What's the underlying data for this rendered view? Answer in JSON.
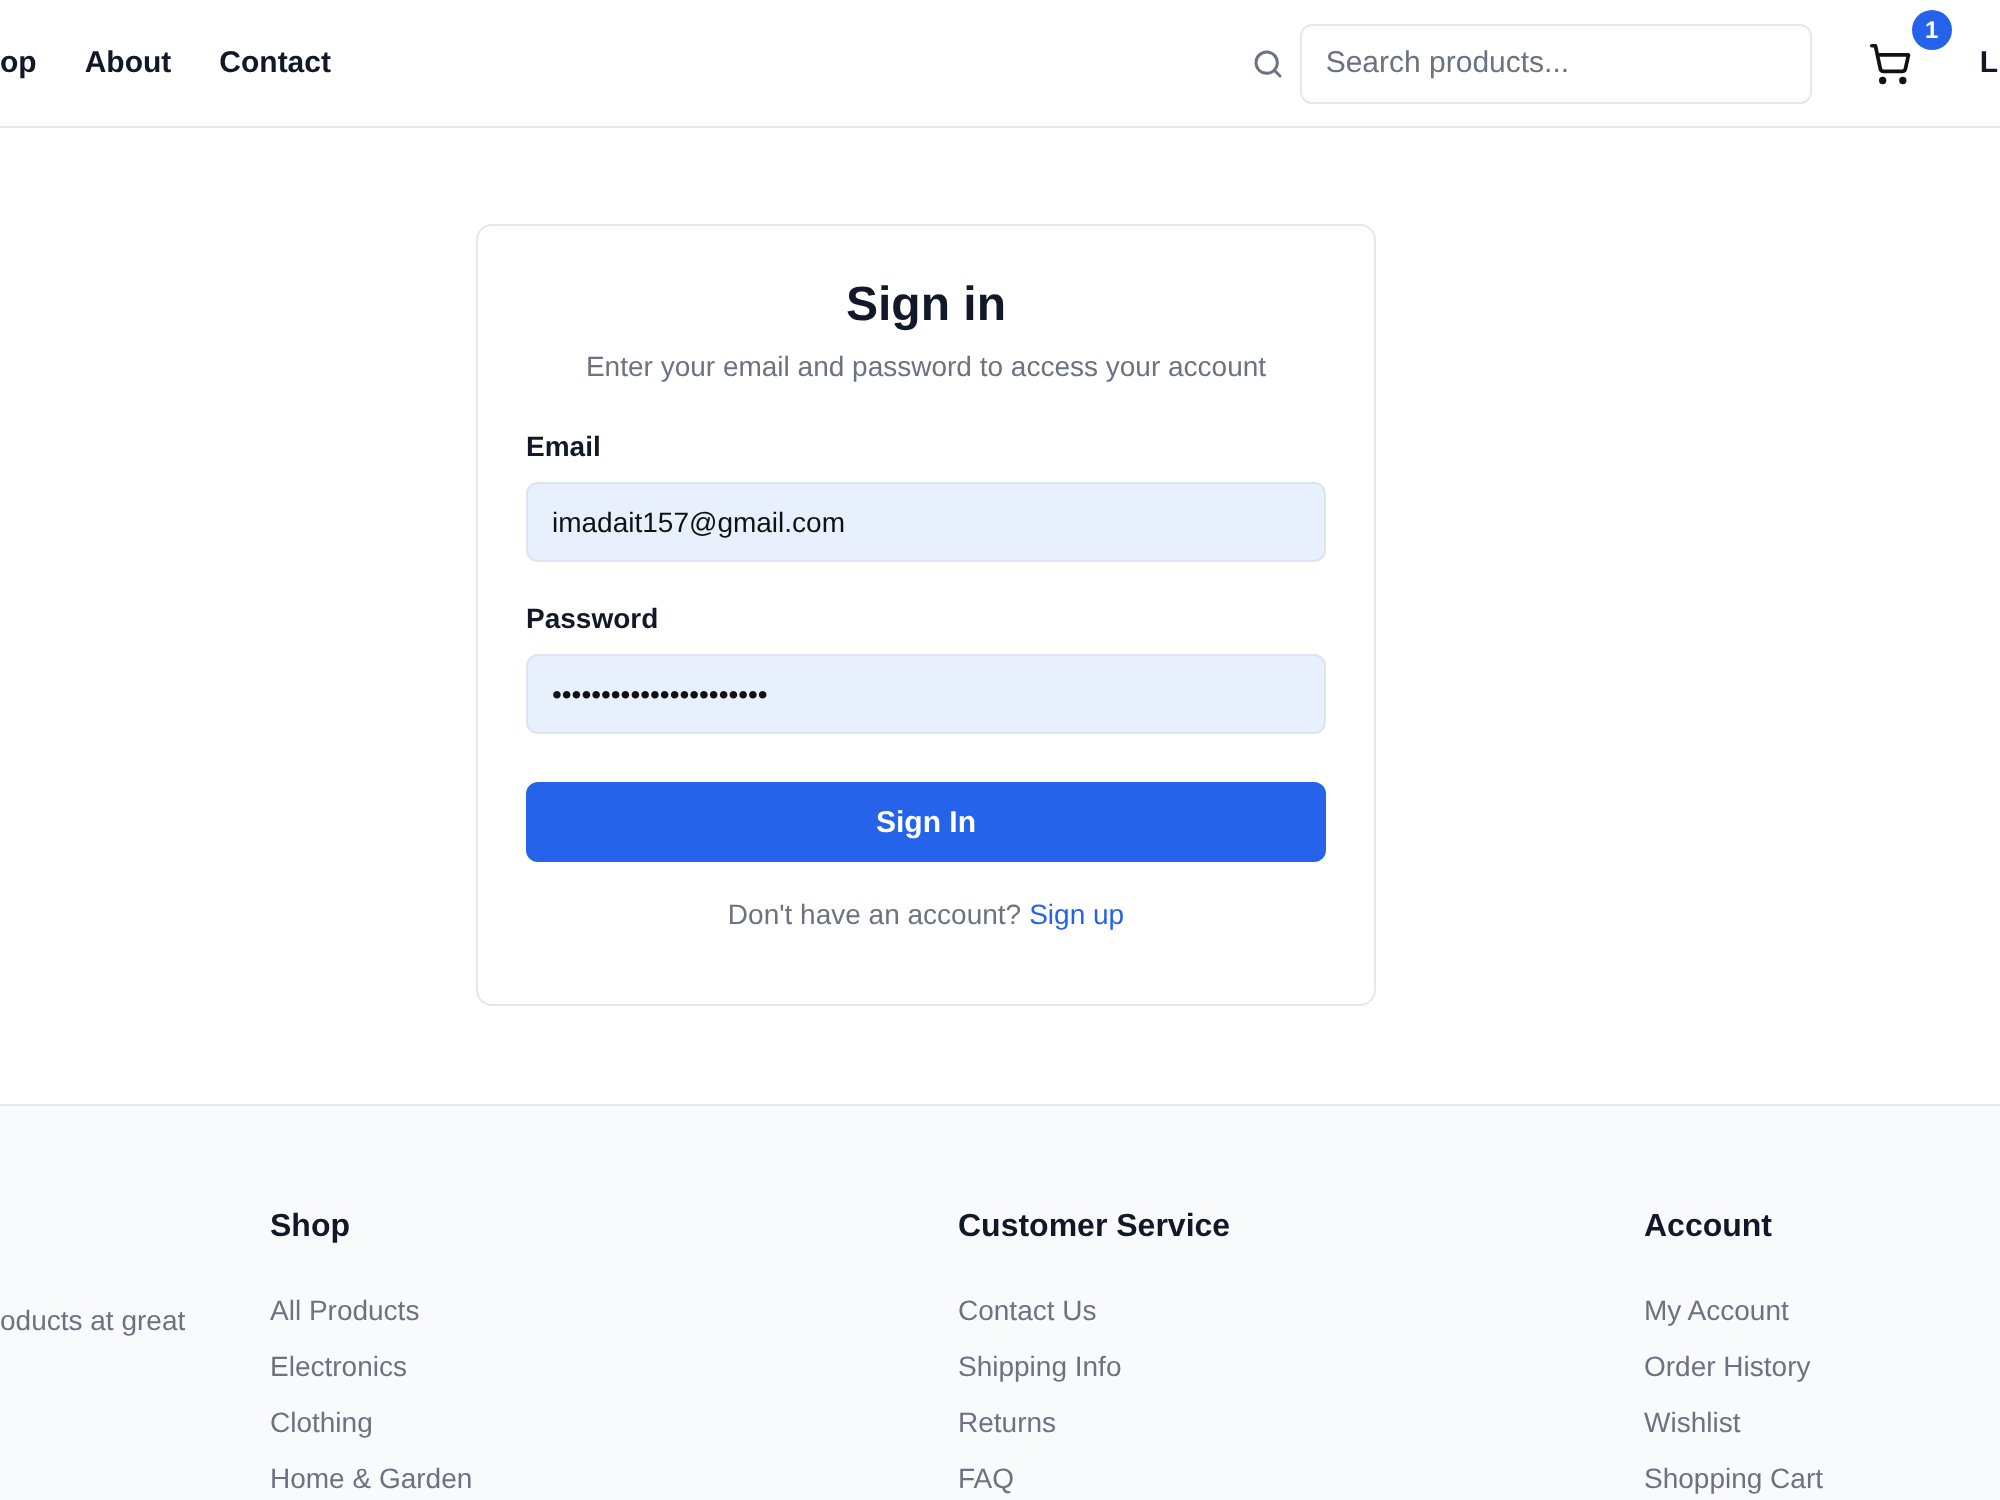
{
  "header": {
    "nav": [
      "op",
      "About",
      "Contact"
    ],
    "search": {
      "placeholder": "Search products..."
    },
    "cart_count": "1",
    "edge_link": "L"
  },
  "signin": {
    "title": "Sign in",
    "subtitle": "Enter your email and password to access your account",
    "fields": [
      {
        "label": "Email",
        "value": "imadait157@gmail.com"
      },
      {
        "label": "Password",
        "value": "••••••••••••••••••••••"
      }
    ],
    "button": "Sign In",
    "prompt": "Don't have an account?",
    "link": "Sign up"
  },
  "footer": {
    "blurb": "oducts at great",
    "columns": [
      {
        "title": "Shop",
        "links": [
          "All Products",
          "Electronics",
          "Clothing",
          "Home & Garden"
        ]
      },
      {
        "title": "Customer Service",
        "links": [
          "Contact Us",
          "Shipping Info",
          "Returns",
          "FAQ"
        ]
      },
      {
        "title": "Account",
        "links": [
          "My Account",
          "Order History",
          "Wishlist",
          "Shopping Cart"
        ]
      }
    ]
  }
}
